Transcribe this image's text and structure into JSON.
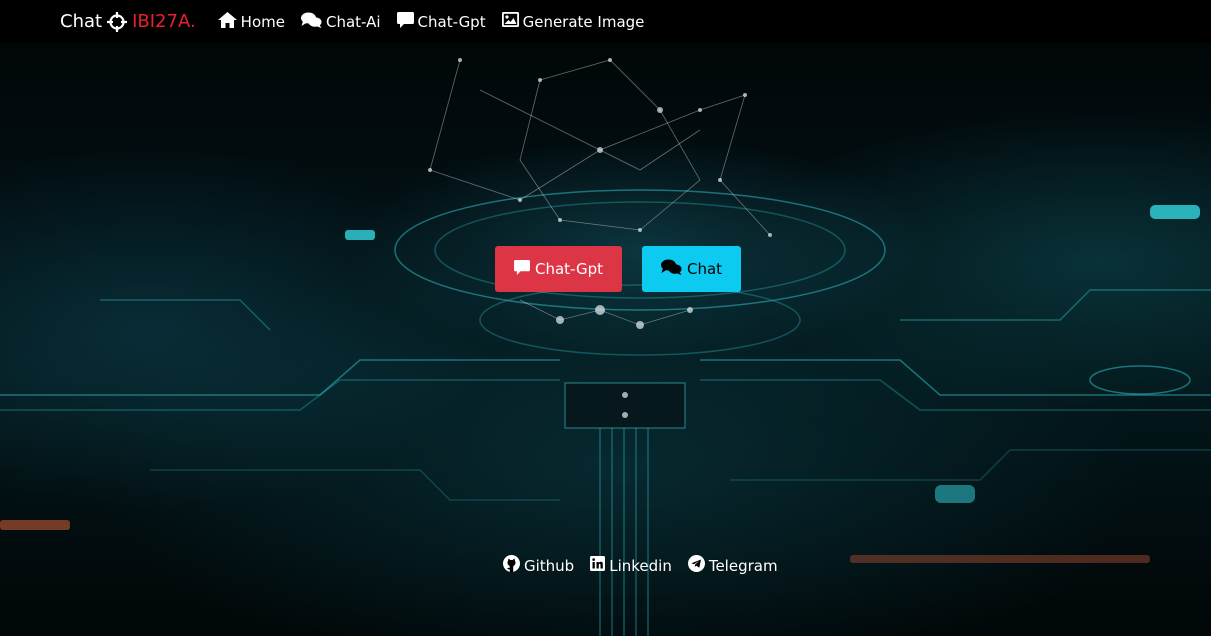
{
  "navbar": {
    "brand_prefix": "Chat",
    "brand_accent": "IBI27A.",
    "items": [
      {
        "label": "Home",
        "icon": "home-icon"
      },
      {
        "label": "Chat-Ai",
        "icon": "comments-icon"
      },
      {
        "label": "Chat-Gpt",
        "icon": "comment-icon"
      },
      {
        "label": "Generate Image",
        "icon": "image-icon"
      }
    ]
  },
  "hero": {
    "chatgpt_button": "Chat-Gpt",
    "chat_button": "Chat"
  },
  "footer": {
    "links": [
      {
        "label": "Github",
        "icon": "github-icon"
      },
      {
        "label": "Linkedin",
        "icon": "linkedin-icon"
      },
      {
        "label": "Telegram",
        "icon": "telegram-icon"
      }
    ]
  },
  "colors": {
    "accent_red": "#dc3545",
    "accent_cyan": "#0dcaf0",
    "brand_red": "#e8212b",
    "navbar_bg": "#000000"
  }
}
